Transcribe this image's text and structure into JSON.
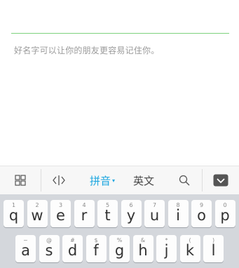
{
  "form": {
    "name_value": "",
    "hint": "好名字可以让你的朋友更容易记住你。"
  },
  "toolbar": {
    "grid_icon": "grid-icon",
    "cursor_icon": "cursor-move-icon",
    "pinyin_label": "拼音",
    "pinyin_caret": "▾",
    "english_label": "英文",
    "search_icon": "search-icon",
    "collapse_icon": "collapse-keyboard-icon"
  },
  "colors": {
    "accent": "#1ea7e0",
    "input_line": "#7ed27e"
  },
  "keyboard": {
    "row1": [
      {
        "letter": "q",
        "sub": "1"
      },
      {
        "letter": "w",
        "sub": "2"
      },
      {
        "letter": "e",
        "sub": "3"
      },
      {
        "letter": "r",
        "sub": "4"
      },
      {
        "letter": "t",
        "sub": "5"
      },
      {
        "letter": "y",
        "sub": "6"
      },
      {
        "letter": "u",
        "sub": "7"
      },
      {
        "letter": "i",
        "sub": "8"
      },
      {
        "letter": "o",
        "sub": "9"
      },
      {
        "letter": "p",
        "sub": "0"
      }
    ],
    "row2": [
      {
        "letter": "a",
        "sub": "~"
      },
      {
        "letter": "s",
        "sub": "@"
      },
      {
        "letter": "d",
        "sub": "#"
      },
      {
        "letter": "f",
        "sub": "$"
      },
      {
        "letter": "g",
        "sub": "%"
      },
      {
        "letter": "h",
        "sub": "&"
      },
      {
        "letter": "j",
        "sub": "*"
      },
      {
        "letter": "k",
        "sub": "("
      },
      {
        "letter": "l",
        "sub": ")"
      }
    ]
  }
}
